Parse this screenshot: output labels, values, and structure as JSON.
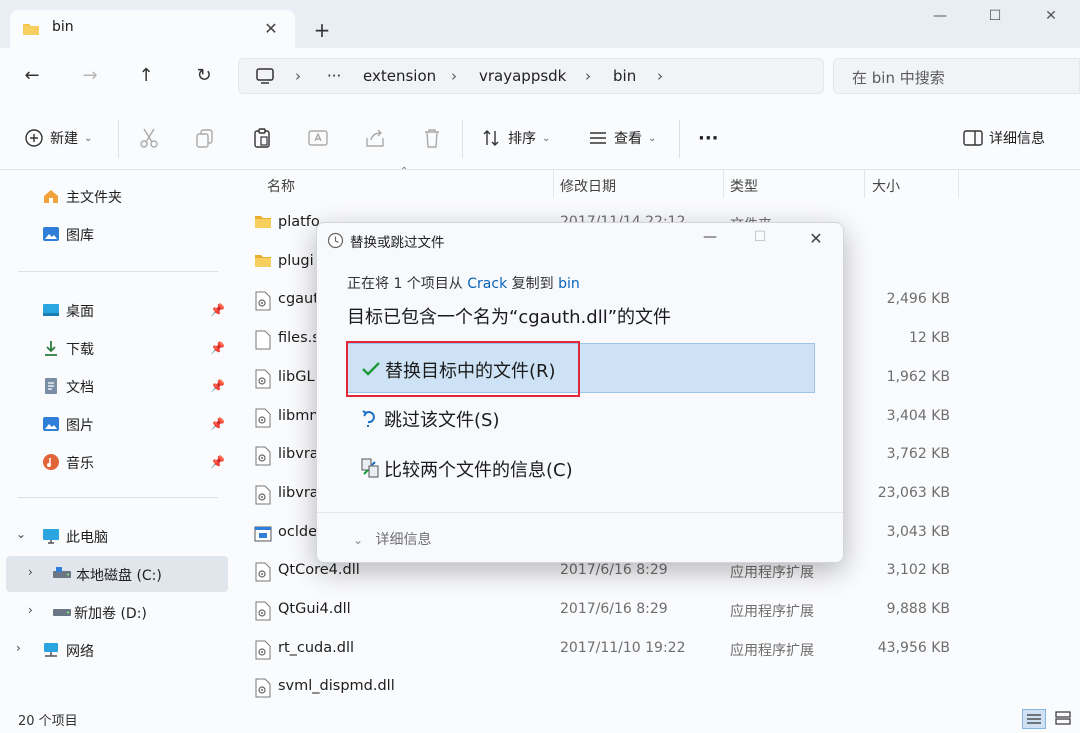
{
  "window": {
    "tab_title": "bin",
    "tab_close": "✕",
    "new_tab": "+",
    "minimize": "—",
    "maximize": "☐",
    "close": "✕"
  },
  "nav": {
    "more": "···",
    "crumbs": [
      "extension",
      "vrayappsdk",
      "bin"
    ],
    "search_placeholder": "在 bin 中搜索"
  },
  "toolbar": {
    "new_label": "新建",
    "sort_label": "排序",
    "view_label": "查看",
    "more_label": "···",
    "details_label": "详细信息"
  },
  "sidebar": {
    "home": "主文件夹",
    "gallery": "图库",
    "desktop": "桌面",
    "downloads": "下载",
    "documents": "文档",
    "pictures": "图片",
    "music": "音乐",
    "this_pc": "此电脑",
    "local_disk": "本地磁盘 (C:)",
    "new_volume": "新加卷 (D:)",
    "network": "网络"
  },
  "columns": {
    "name": "名称",
    "date": "修改日期",
    "type": "类型",
    "size": "大小"
  },
  "files": [
    {
      "name": "platfo",
      "date": "2017/11/14 22:12",
      "type": "文件夹",
      "size": "",
      "kind": "folder"
    },
    {
      "name": "plugi",
      "date": "",
      "type": "",
      "size": "",
      "kind": "folder"
    },
    {
      "name": "cgaut",
      "date": "",
      "type": "",
      "size": "2,496 KB",
      "kind": "dll"
    },
    {
      "name": "files.s",
      "date": "",
      "type": "",
      "size": "12 KB",
      "kind": "file"
    },
    {
      "name": "libGL",
      "date": "",
      "type": "",
      "size": "1,962 KB",
      "kind": "dll"
    },
    {
      "name": "libmn",
      "date": "",
      "type": "",
      "size": "3,404 KB",
      "kind": "dll"
    },
    {
      "name": "libvra",
      "date": "",
      "type": "",
      "size": "3,762 KB",
      "kind": "dll"
    },
    {
      "name": "libvra",
      "date": "",
      "type": "",
      "size": "23,063 KB",
      "kind": "dll"
    },
    {
      "name": "oclde",
      "date": "",
      "type": "",
      "size": "3,043 KB",
      "kind": "exe"
    },
    {
      "name": "QtCore4.dll",
      "date": "2017/6/16 8:29",
      "type": "应用程序扩展",
      "size": "3,102 KB",
      "kind": "dll"
    },
    {
      "name": "QtGui4.dll",
      "date": "2017/6/16 8:29",
      "type": "应用程序扩展",
      "size": "9,888 KB",
      "kind": "dll"
    },
    {
      "name": "rt_cuda.dll",
      "date": "2017/11/10 19:22",
      "type": "应用程序扩展",
      "size": "43,956 KB",
      "kind": "dll"
    },
    {
      "name": "svml_dispmd.dll",
      "date": "",
      "type": "",
      "size": "",
      "kind": "dll"
    }
  ],
  "status": {
    "count": "20 个项目"
  },
  "dialog": {
    "title": "替换或跳过文件",
    "line_prefix": "正在将 1 个项目从",
    "source": "Crack",
    "line_mid": "复制到",
    "dest": "bin",
    "heading": "目标已包含一个名为“cgauth.dll”的文件",
    "opt_replace": "替换目标中的文件(R)",
    "opt_skip": "跳过该文件(S)",
    "opt_compare": "比较两个文件的信息(C)",
    "more_details": "详细信息"
  },
  "colors": {
    "accent": "#0a63b9",
    "highlight": "#cde3f5",
    "red_box": "#e0283a",
    "folder": "#f3c34b"
  }
}
